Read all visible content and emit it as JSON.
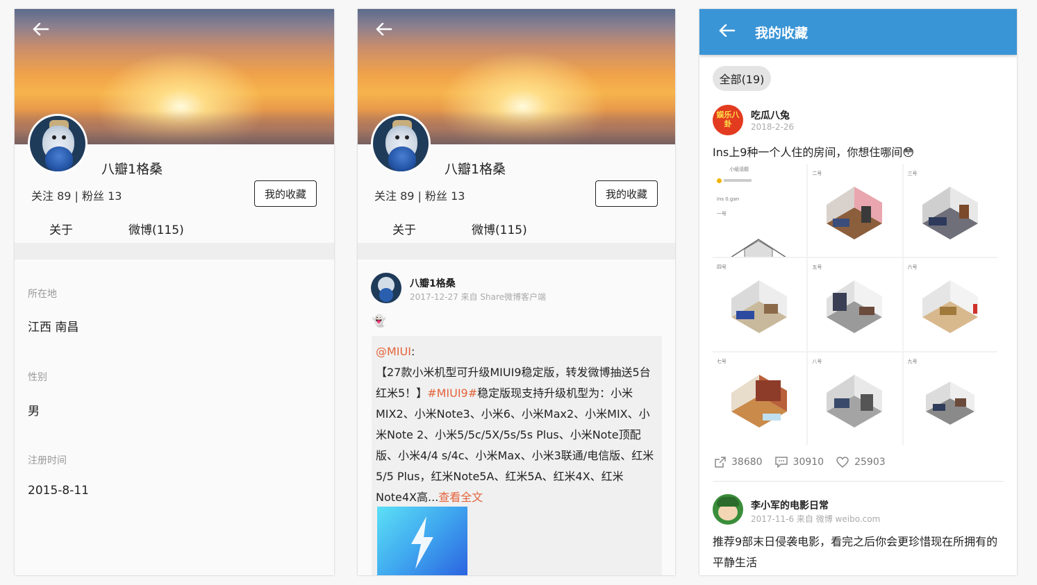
{
  "profile_about": {
    "username": "八瓣1格桑",
    "follow_stats": "关注 89 | 粉丝 13",
    "favorites_button": "我的收藏",
    "tabs": [
      "关于",
      "微博(115)"
    ],
    "location_label": "所在地",
    "location_value": "江西 南昌",
    "gender_label": "性别",
    "gender_value": "男",
    "register_label": "注册时间",
    "register_value": "2015-8-11"
  },
  "profile_weibo": {
    "username": "八瓣1格桑",
    "follow_stats": "关注 89 | 粉丝 13",
    "favorites_button": "我的收藏",
    "tabs": [
      "关于",
      "微博(115)"
    ],
    "post": {
      "author": "八瓣1格桑",
      "meta": "2017-12-27 来自 Share微博客户端",
      "emoji": "👻",
      "repost_mention": "@MIUI",
      "repost_colon": ":",
      "repost_text_1": "【27款小米机型可升级MIUI9稳定版，转发微博抽送5台红米5！】",
      "repost_tag": "#MIUI9#",
      "repost_text_2": "稳定版现支持升级机型为：小米MIX2、小米Note3、小米6、小米Max2、小米MIX、小米Note 2、小米5/5c/5X/5s/5s Plus、小米Note顶配版、小米4/4 s/4c、小米Max、小米3联通/电信版、红米5/5 Plus，红米Note5A、红米5A、红米4X、红米Note4X高...",
      "repost_more": "查看全文"
    }
  },
  "favorites": {
    "title": "我的收藏",
    "filter_chip": "全部(19)",
    "items": [
      {
        "author": "吃瓜八兔",
        "avatar_text": "娱乐八卦",
        "date": "2018-2-26",
        "text": "Ins上9种一个人住的房间，你想住哪间😳",
        "grid_labels": [
          "一号",
          "二号",
          "三号",
          "四号",
          "五号",
          "六号",
          "七号",
          "八号",
          "九号"
        ],
        "cell1_header": "小组话题",
        "cell1_text": "ins 0.gan",
        "reposts": "38680",
        "comments": "30910",
        "likes": "25903"
      },
      {
        "author": "李小军的电影日常",
        "date": "2017-11-6 来自 微博 weibo.com",
        "text": "推荐9部末日侵袭电影，看完之后你会更珍惜现在所拥有的平静生活"
      }
    ]
  },
  "colors": {
    "accent_blue": "#3a95d6",
    "link_orange": "#e4633c"
  },
  "icons": [
    "back-arrow-icon",
    "repost-icon",
    "comment-icon",
    "like-icon",
    "lightning-icon"
  ]
}
